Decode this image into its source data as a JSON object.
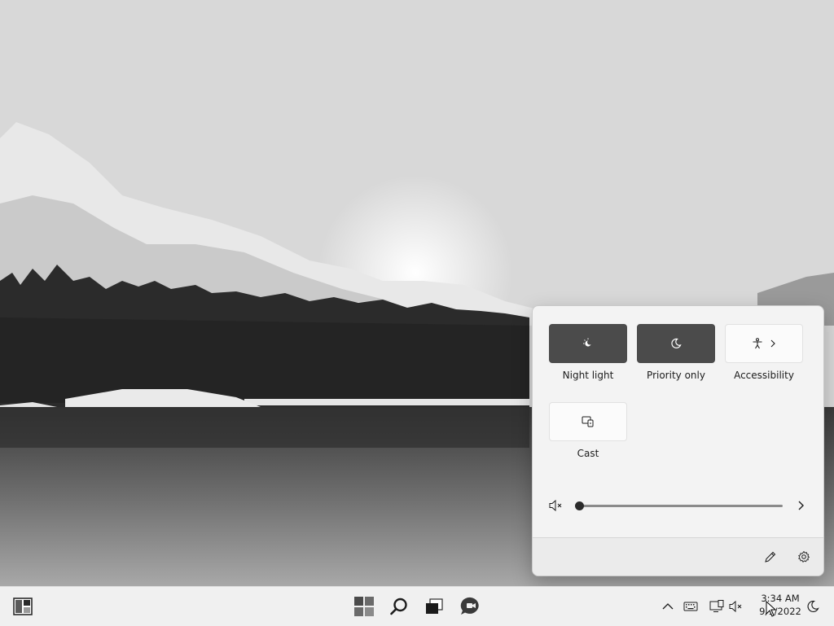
{
  "quick_settings": {
    "tiles": [
      {
        "label": "Night light",
        "icon": "night-light-icon",
        "active": true
      },
      {
        "label": "Priority only",
        "icon": "moon-icon",
        "active": true
      },
      {
        "label": "Accessibility",
        "icon": "accessibility-icon",
        "active": false,
        "has_chevron": true
      },
      {
        "label": "Cast",
        "icon": "cast-icon",
        "active": false
      }
    ],
    "volume": {
      "icon": "speaker-muted-icon",
      "level": 0,
      "expand_icon": "chevron-right-icon"
    },
    "footer": {
      "edit_icon": "pencil-icon",
      "settings_icon": "gear-icon"
    }
  },
  "taskbar": {
    "widgets_icon": "widgets-icon",
    "start_icon": "windows-start-icon",
    "search_icon": "search-icon",
    "taskview_icon": "task-view-icon",
    "chat_icon": "chat-icon",
    "tray": {
      "overflow_icon": "chevron-up-icon",
      "keyboard_icon": "keyboard-icon",
      "network_icon": "network-icon",
      "volume_icon": "speaker-muted-icon",
      "focus_icon": "moon-icon"
    },
    "clock": {
      "time": "3:34 AM",
      "date": "9/1/2022"
    }
  },
  "colors": {
    "tile_active": "#4b4b4b",
    "panel_bg": "#f3f3f3",
    "taskbar_bg": "#f0f0f0"
  }
}
